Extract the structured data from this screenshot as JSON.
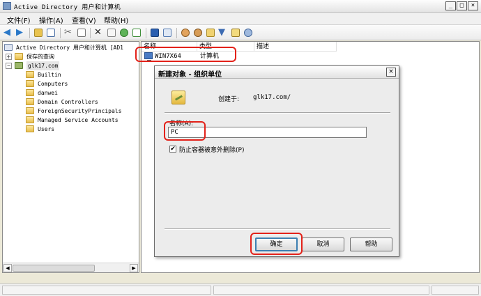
{
  "window": {
    "title": "Active Directory 用户和计算机",
    "minimize": "_",
    "maximize": "□",
    "close": "×"
  },
  "menu": [
    "文件(F)",
    "操作(A)",
    "查看(V)",
    "帮助(H)"
  ],
  "toolbar_icons": [
    "back-icon",
    "forward-icon",
    "up-icon",
    "show-hide-tree-icon",
    "cut-icon",
    "copy-icon",
    "delete-icon",
    "properties-icon",
    "refresh-icon",
    "export-icon",
    "help-icon",
    "view-icon",
    "new-user-icon",
    "new-group-icon",
    "new-ou-icon",
    "filter-icon",
    "find-icon",
    "add-to-group-icon"
  ],
  "tree": {
    "root": "Active Directory 用户和计算机 [AD1",
    "saved_queries": "保存的查询",
    "domain": "glk17.com",
    "children": [
      "Builtin",
      "Computers",
      "danwei",
      "Domain Controllers",
      "ForeignSecurityPrincipals",
      "Managed Service Accounts",
      "Users"
    ],
    "expand_plus": "+",
    "expand_minus": "−"
  },
  "list": {
    "columns": [
      "名称",
      "类型",
      "描述"
    ],
    "rows": [
      {
        "name": "WIN7X64",
        "type": "计算机",
        "desc": ""
      }
    ]
  },
  "dialog": {
    "title": "新建对象 - 组织单位",
    "close": "×",
    "created_in_label": "创建于:",
    "created_in_value": "glk17.com/",
    "name_label": "名称(A):",
    "name_value": "PC",
    "protect_checked": "✔",
    "protect_label": "防止容器被意外删除(P)",
    "ok": "确定",
    "cancel": "取消",
    "help": "帮助"
  },
  "colors": {
    "highlight": "#e32119",
    "selection": "#cce4f7",
    "folder": "#f2d16b"
  }
}
